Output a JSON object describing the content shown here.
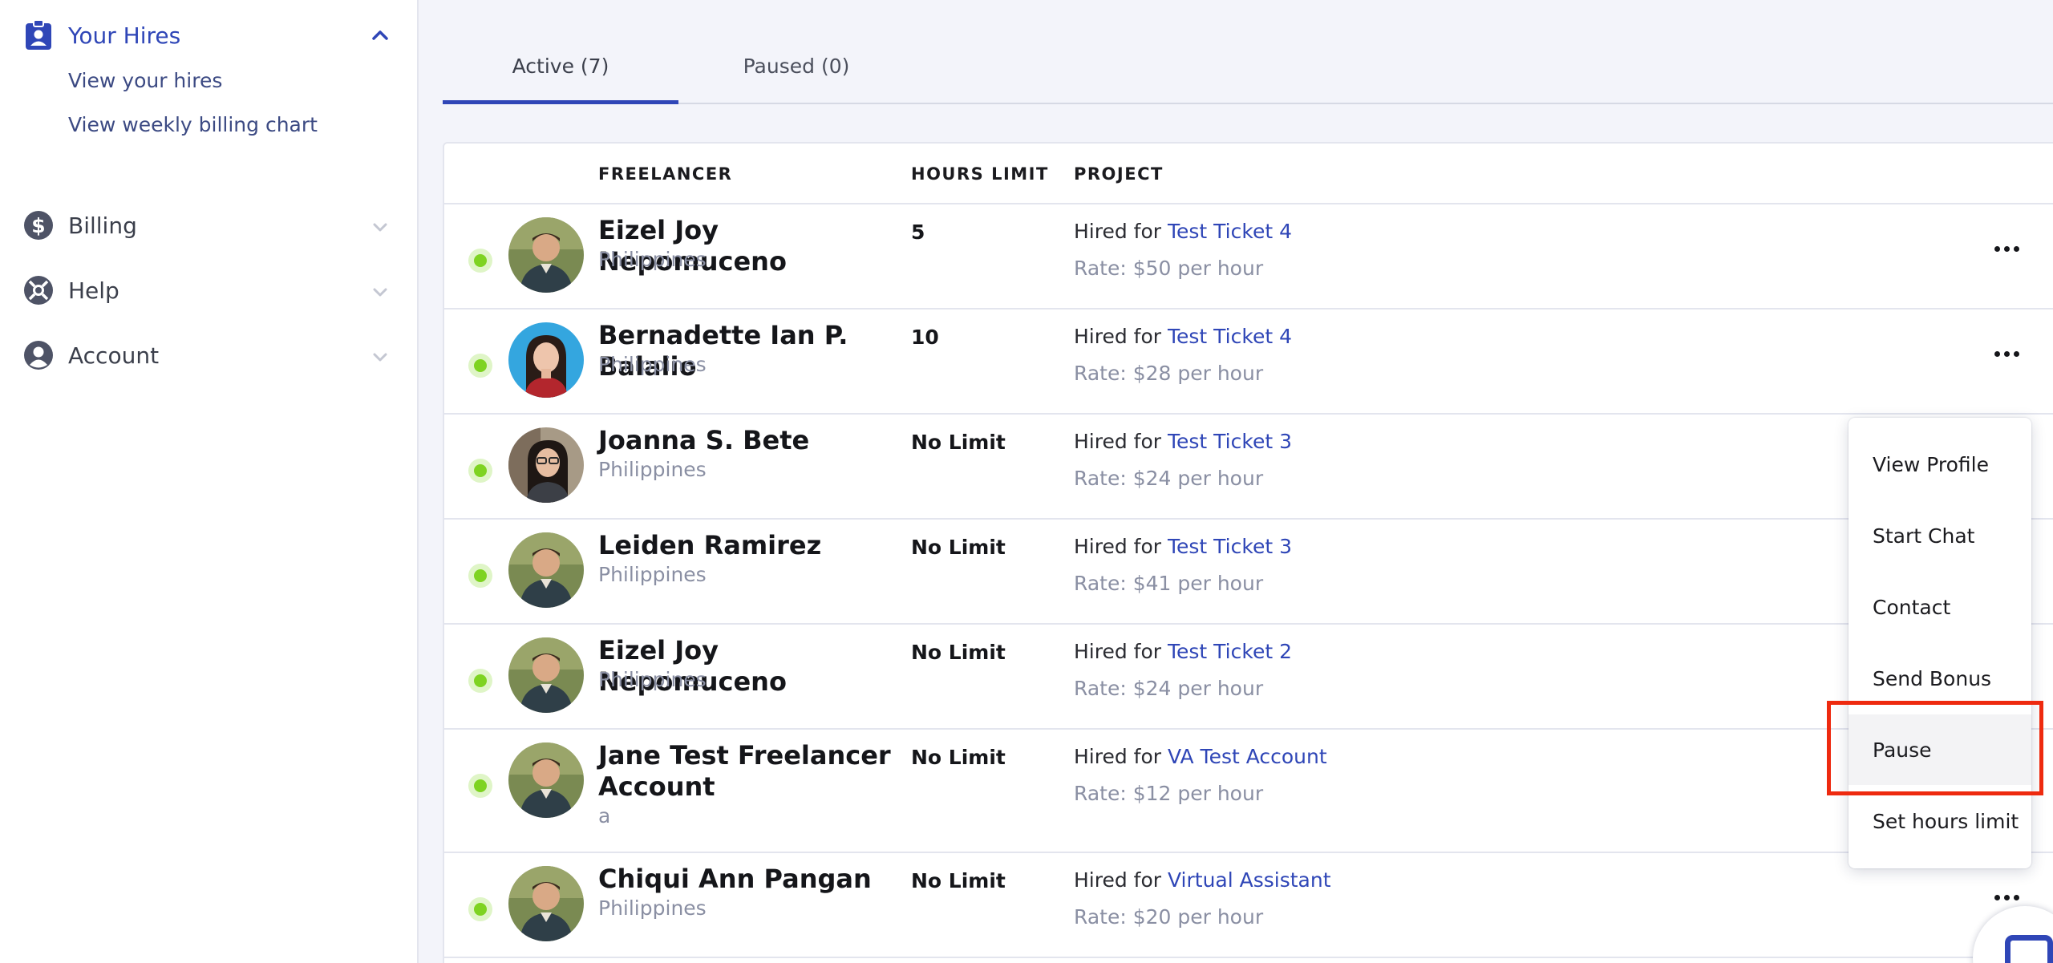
{
  "sidebar": {
    "your_hires": {
      "label": "Your Hires",
      "sub_items": [
        {
          "label": "View your hires"
        },
        {
          "label": "View weekly billing chart"
        }
      ]
    },
    "billing": {
      "label": "Billing"
    },
    "help": {
      "label": "Help"
    },
    "account": {
      "label": "Account"
    }
  },
  "tabs": [
    {
      "label": "Active (7)",
      "active": true
    },
    {
      "label": "Paused (0)",
      "active": false
    }
  ],
  "table": {
    "headers": {
      "freelancer": "FREELANCER",
      "hours_limit": "HOURS LIMIT",
      "project": "PROJECT"
    },
    "hired_prefix": "Hired for",
    "rows": [
      {
        "name": "Eizel Joy Nepomuceno",
        "country": "Philippines",
        "hours_limit": "5",
        "project": "Test Ticket 4",
        "rate": "Rate: $50 per hour"
      },
      {
        "name": "Bernadette Ian P. Balalio",
        "country": "Philippines",
        "hours_limit": "10",
        "project": "Test Ticket 4",
        "rate": "Rate: $28 per hour"
      },
      {
        "name": "Joanna S. Bete",
        "country": "Philippines",
        "hours_limit": "No Limit",
        "project": "Test Ticket 3",
        "rate": "Rate: $24 per hour"
      },
      {
        "name": "Leiden Ramirez",
        "country": "Philippines",
        "hours_limit": "No Limit",
        "project": "Test Ticket 3",
        "rate": "Rate: $41 per hour"
      },
      {
        "name": "Eizel Joy Nepomuceno",
        "country": "Philippines",
        "hours_limit": "No Limit",
        "project": "Test Ticket 2",
        "rate": "Rate: $24 per hour"
      },
      {
        "name": "Jane Test Freelancer Account",
        "country": "a",
        "hours_limit": "No Limit",
        "project": "VA Test Account",
        "rate": "Rate: $12 per hour"
      },
      {
        "name": "Chiqui Ann Pangan",
        "country": "Philippines",
        "hours_limit": "No Limit",
        "project": "Virtual Assistant",
        "rate": "Rate: $20 per hour"
      }
    ]
  },
  "dropdown_menu": {
    "items": [
      {
        "label": "View Profile"
      },
      {
        "label": "Start Chat"
      },
      {
        "label": "Contact"
      },
      {
        "label": "Send Bonus"
      },
      {
        "label": "Pause",
        "highlighted": true
      },
      {
        "label": "Set hours limit"
      }
    ]
  },
  "colors": {
    "accent": "#2f46b7",
    "status_online": "#7ed321",
    "highlight_box": "#ee2a0f",
    "background": "#f3f4fa"
  }
}
